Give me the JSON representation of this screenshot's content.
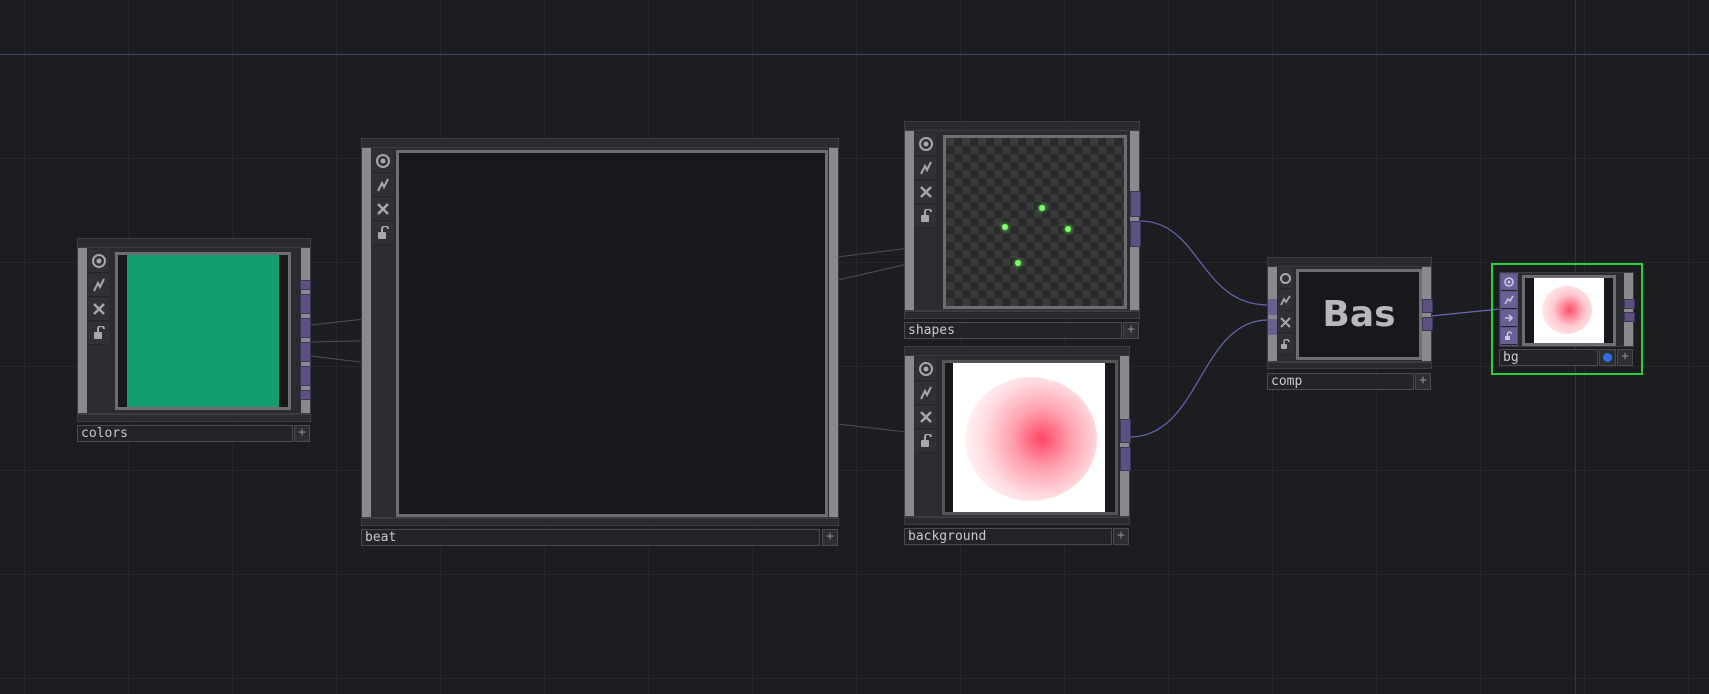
{
  "network": {
    "nodes": {
      "colors": {
        "name": "colors",
        "swatch_color": "#129e6e"
      },
      "beat": {
        "name": "beat"
      },
      "shapes": {
        "name": "shapes",
        "dot_color": "#7dff6a"
      },
      "background": {
        "name": "background",
        "blob_color": "#ff3e5c"
      },
      "comp": {
        "name": "comp",
        "viewer_text": "Bas"
      },
      "bg": {
        "name": "bg",
        "selected": true,
        "selection_color": "#2bd13b",
        "flag_color": "#2f6fe0"
      }
    },
    "node_buttons": [
      "viewer-toggle-icon",
      "bypass-icon",
      "cook-off-icon",
      "lock-icon"
    ],
    "plus_glyph": "+",
    "wire_color": "#6b63b5",
    "grid_line_color": "#44456a"
  }
}
